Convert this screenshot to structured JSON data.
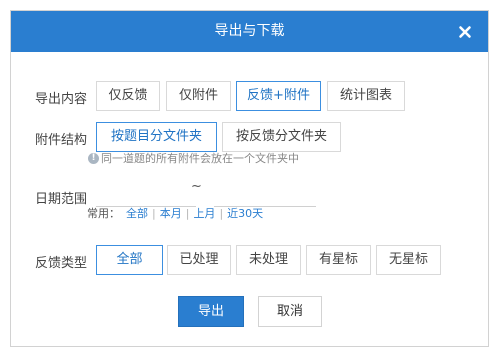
{
  "dialog": {
    "title": "导出与下载",
    "close_icon": "close-icon"
  },
  "export_content": {
    "label": "导出内容",
    "options": [
      {
        "label": "仅反馈",
        "selected": false
      },
      {
        "label": "仅附件",
        "selected": false
      },
      {
        "label": "反馈+附件",
        "selected": true
      },
      {
        "label": "统计图表",
        "selected": false
      }
    ]
  },
  "attachment_structure": {
    "label": "附件结构",
    "options": [
      {
        "label": "按题目分文件夹",
        "selected": true
      },
      {
        "label": "按反馈分文件夹",
        "selected": false
      }
    ],
    "hint_icon": "info-icon",
    "hint": "同一道题的所有附件会放在一个文件夹中"
  },
  "date_range": {
    "label": "日期范围",
    "start_value": "",
    "end_value": "",
    "separator": "~",
    "quick_label": "常用：",
    "quick_links": [
      "全部",
      "本月",
      "上月",
      "近30天"
    ]
  },
  "feedback_type": {
    "label": "反馈类型",
    "options": [
      {
        "label": "全部",
        "selected": true
      },
      {
        "label": "已处理",
        "selected": false
      },
      {
        "label": "未处理",
        "selected": false
      },
      {
        "label": "有星标",
        "selected": false
      },
      {
        "label": "无星标",
        "selected": false
      }
    ]
  },
  "actions": {
    "export_label": "导出",
    "cancel_label": "取消"
  },
  "colors": {
    "accent": "#2a7ed0",
    "selected_border": "#3c8fe0",
    "border": "#d9d9d9"
  }
}
